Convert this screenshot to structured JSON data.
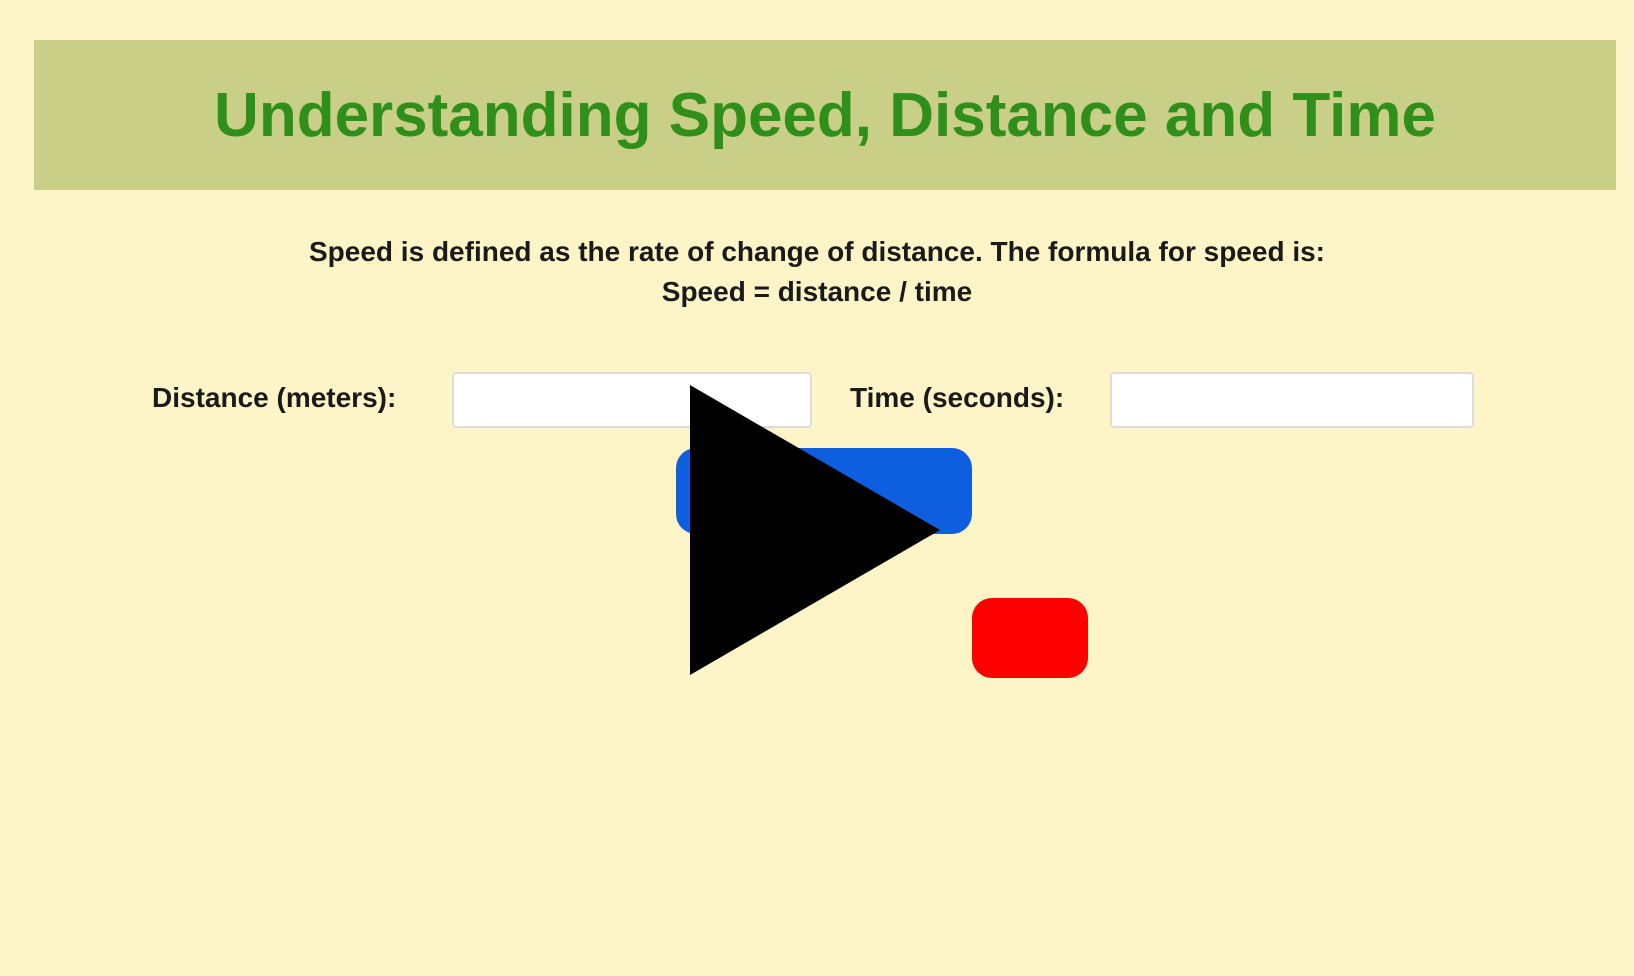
{
  "header": {
    "title": "Understanding Speed, Distance and Time"
  },
  "intro": {
    "line1": "Speed is defined as the rate of change of distance. The formula for speed is:",
    "line2": "Speed = distance / time"
  },
  "form": {
    "distance_label": "Distance (meters):",
    "distance_value": "",
    "time_label": "Time (seconds):",
    "time_value": ""
  },
  "buttons": {
    "calculate_color": "#0d5fe0",
    "stop_color": "#ff0000"
  },
  "overlay": {
    "icon": "play-icon"
  },
  "colors": {
    "background": "#fdf5c7",
    "banner": "#c9cf86",
    "title": "#2f8f1a"
  }
}
